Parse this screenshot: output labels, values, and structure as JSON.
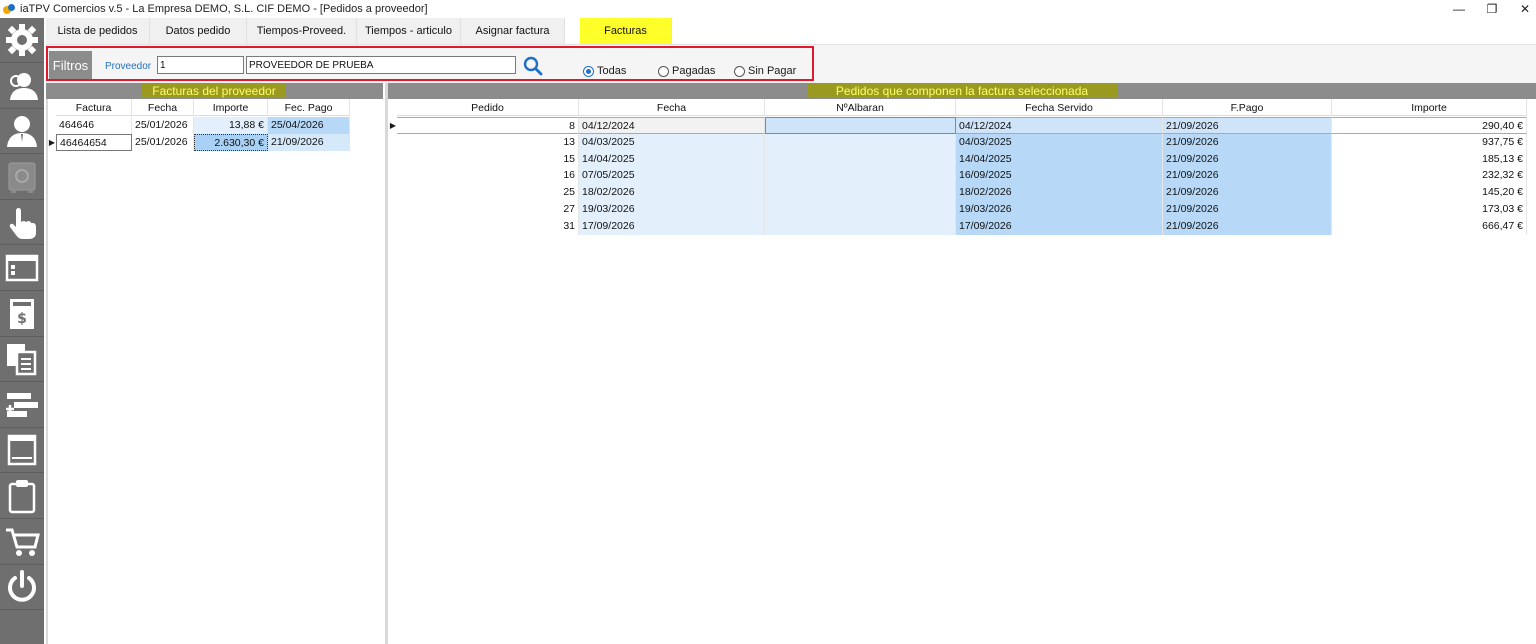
{
  "window": {
    "title": "iaTPV Comercios v.5 - La Empresa DEMO, S.L. CIF DEMO - [Pedidos a proveedor]",
    "min_glyph": "—",
    "restore_glyph": "❐",
    "close_glyph": "✕"
  },
  "sidebar": {
    "items": [
      {
        "icon": "gear-icon"
      },
      {
        "icon": "users-icon"
      },
      {
        "icon": "user-icon"
      },
      {
        "icon": "safe-icon"
      },
      {
        "icon": "hand-pointer-icon"
      },
      {
        "icon": "window-icon"
      },
      {
        "icon": "invoice-icon"
      },
      {
        "icon": "copy-document-icon"
      },
      {
        "icon": "add-list-icon"
      },
      {
        "icon": "panel-icon"
      },
      {
        "icon": "clipboard-icon"
      },
      {
        "icon": "cart-icon"
      },
      {
        "icon": "power-icon"
      }
    ]
  },
  "tabs": [
    {
      "label": "Lista de pedidos",
      "active": false
    },
    {
      "label": "Datos pedido",
      "active": false
    },
    {
      "label": "Tiempos-Proveed.",
      "active": false
    },
    {
      "label": "Tiempos - articulo",
      "active": false
    },
    {
      "label": "Asignar factura",
      "active": false
    },
    {
      "label": "Facturas",
      "active": true
    }
  ],
  "filters": {
    "title": "Filtros",
    "provider_label": "Proveedor",
    "provider_code": "1",
    "provider_name": "PROVEEDOR DE PRUEBA",
    "radio_options": [
      {
        "label": "Todas",
        "selected": true
      },
      {
        "label": "Pagadas",
        "selected": false
      },
      {
        "label": "Sin Pagar",
        "selected": false
      }
    ]
  },
  "invoices_panel": {
    "title": "Facturas del proveedor",
    "columns": [
      "Factura",
      "Fecha",
      "Importe",
      "Fec. Pago"
    ],
    "rows": [
      {
        "factura": "464646",
        "fecha": "25/01/2026",
        "importe": "13,88 €",
        "fec_pago": "25/04/2026",
        "current": false
      },
      {
        "factura": "46464654",
        "fecha": "25/01/2026",
        "importe": "2.630,30 €",
        "fec_pago": "21/09/2026",
        "current": true
      }
    ]
  },
  "orders_panel": {
    "title": "Pedidos que componen la factura seleccionada",
    "columns": [
      "Pedido",
      "Fecha",
      "NºAlbaran",
      "Fecha Servido",
      "F.Pago",
      "Importe"
    ],
    "rows": [
      {
        "pedido": "8",
        "fecha": "04/12/2024",
        "albaran": "",
        "fecha_servido": "04/12/2024",
        "f_pago": "21/09/2026",
        "importe": "290,40 €",
        "current": true
      },
      {
        "pedido": "13",
        "fecha": "04/03/2025",
        "albaran": "",
        "fecha_servido": "04/03/2025",
        "f_pago": "21/09/2026",
        "importe": "937,75 €",
        "current": false
      },
      {
        "pedido": "15",
        "fecha": "14/04/2025",
        "albaran": "",
        "fecha_servido": "14/04/2025",
        "f_pago": "21/09/2026",
        "importe": "185,13 €",
        "current": false
      },
      {
        "pedido": "16",
        "fecha": "07/05/2025",
        "albaran": "",
        "fecha_servido": "16/09/2025",
        "f_pago": "21/09/2026",
        "importe": "232,32 €",
        "current": false
      },
      {
        "pedido": "25",
        "fecha": "18/02/2026",
        "albaran": "",
        "fecha_servido": "18/02/2026",
        "f_pago": "21/09/2026",
        "importe": "145,20 €",
        "current": false
      },
      {
        "pedido": "27",
        "fecha": "19/03/2026",
        "albaran": "",
        "fecha_servido": "19/03/2026",
        "f_pago": "21/09/2026",
        "importe": "173,03 €",
        "current": false
      },
      {
        "pedido": "31",
        "fecha": "17/09/2026",
        "albaran": "",
        "fecha_servido": "17/09/2026",
        "f_pago": "21/09/2026",
        "importe": "666,47 €",
        "current": false
      }
    ]
  },
  "colors": {
    "active_tab": "#ffff29",
    "sidebar": "#6f6f6f",
    "filter_frame": "#e0192d",
    "header_bar": "#8c8c8c",
    "light_blue": "#e3f0fc",
    "mid_blue": "#b7d9f7",
    "link_blue": "#1e6fc7"
  }
}
